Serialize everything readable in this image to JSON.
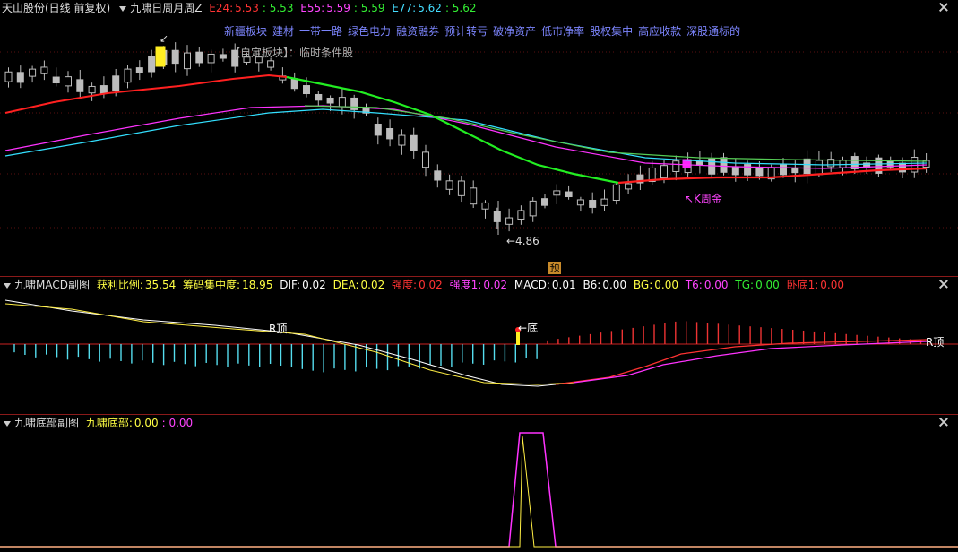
{
  "main": {
    "stock": "天山股份(日线 前复权)",
    "indicator": "九啸日周月周Z",
    "e24_label": "E24:",
    "e24_a": "5.53",
    "e24_b": ": 5.53",
    "e55_label": "E55:",
    "e55_a": "5.59",
    "e55_b": ": 5.59",
    "e77_label": "E77:",
    "e77_a": "5.62",
    "e77_b": ": 5.62",
    "tags": [
      "新疆板块",
      "建材",
      "一带一路",
      "绿色电力",
      "融资融券",
      "预计转亏",
      "破净资产",
      "低市净率",
      "股权集中",
      "高应收款",
      "深股通标的"
    ],
    "note": "【自定板块】：临时条件股",
    "low_label": "←4.86",
    "kzj_label": "↖K周金",
    "pre_badge": "预",
    "colors": {
      "ma24": "#ff2020",
      "ma55": "#ff33ff",
      "ma77": "#33e0ff",
      "fast_green": "#22ee22",
      "slow_green": "#55cc55",
      "tags": "#7d86ff"
    }
  },
  "macd": {
    "title": "九啸MACD副图",
    "profit_label": "获利比例:",
    "profit_value": "35.54",
    "chip_label": "筹码集中度:",
    "chip_value": "18.95",
    "dif_label": "DIF:",
    "dif_value": "0.02",
    "dea_label": "DEA:",
    "dea_value": "0.02",
    "qd_label": "强度:",
    "qd_value": "0.02",
    "qd1_label": "强度1:",
    "qd1_value": "0.02",
    "macd_label": "MACD:",
    "macd_value": "0.01",
    "b6_label": "B6:",
    "b6_value": "0.00",
    "bg_label": "BG:",
    "bg_value": "0.00",
    "t6_label": "T6:",
    "t6_value": "0.00",
    "tg_label": "TG:",
    "tg_value": "0.00",
    "wd_label": "卧底1:",
    "wd_value": "0.00",
    "rtop1": "R顶",
    "rtop2": "R顶",
    "bottom_label": "←底"
  },
  "bottom": {
    "title": "九啸底部副图",
    "label": "九啸底部:",
    "value_a": "0.00",
    "value_b": ": 0.00"
  }
}
